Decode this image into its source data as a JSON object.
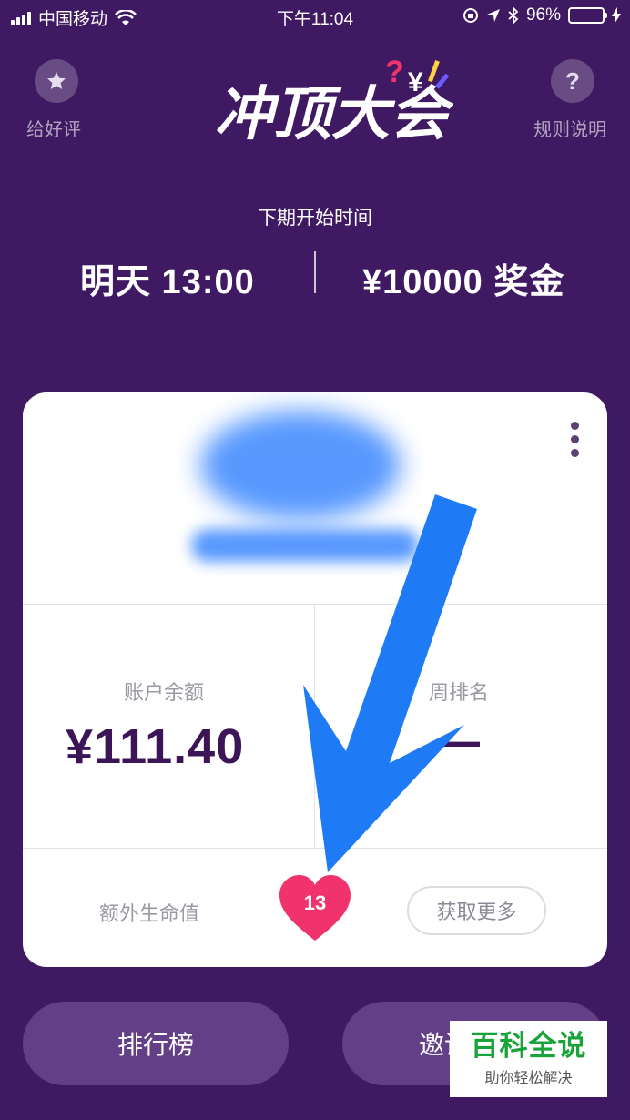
{
  "status_bar": {
    "carrier": "中国移动",
    "time": "下午11:04",
    "battery": "96%"
  },
  "header": {
    "rate_label": "给好评",
    "rules_label": "规则说明",
    "logo_text": "冲顶大会",
    "rules_icon_char": "?"
  },
  "next_game": {
    "label": "下期开始时间",
    "time": "明天  13:00",
    "prize": "¥10000  奖金"
  },
  "card": {
    "balance_label": "账户余额",
    "balance_value": "¥111.40",
    "rank_label": "周排名",
    "rank_value": "—",
    "extra_life_label": "额外生命值",
    "extra_life_count": "13",
    "get_more_label": "获取更多"
  },
  "buttons": {
    "leaderboard": "排行榜",
    "invite": "邀请"
  },
  "watermark": {
    "title": "百科全说",
    "subtitle": "助你轻松解决"
  },
  "colors": {
    "background": "#3f1a62",
    "card": "#ffffff",
    "heart": "#f0336d",
    "arrow": "#1f7bf5",
    "button": "#623f86"
  }
}
